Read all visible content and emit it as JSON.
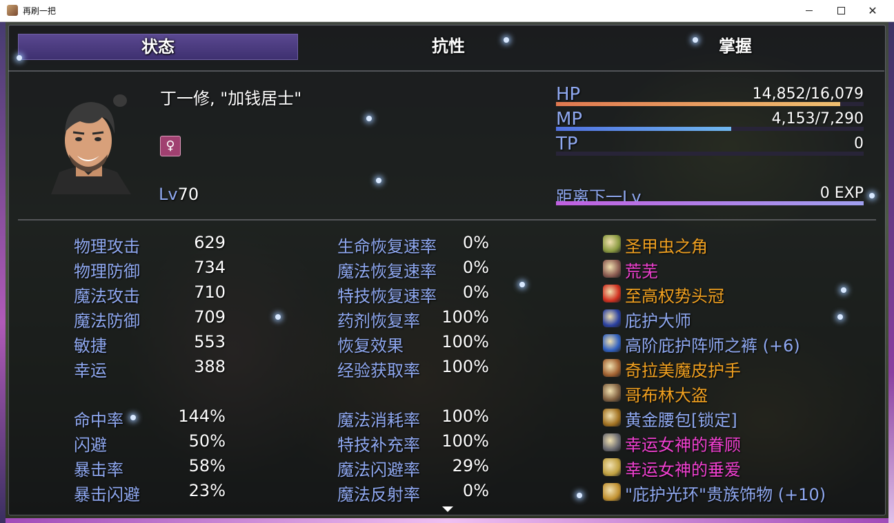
{
  "window": {
    "title": "再刷一把"
  },
  "tabs": [
    {
      "label": "状态"
    },
    {
      "label": "抗性"
    },
    {
      "label": "掌握"
    }
  ],
  "actor": {
    "name": "丁一修, \"加钱居士\"",
    "level_label": "Lv",
    "level": "70",
    "gender_icon": "female-icon"
  },
  "gauges": {
    "hp": {
      "label": "HP",
      "value": "14,852/16,079",
      "ratio": 0.924
    },
    "mp": {
      "label": "MP",
      "value": "4,153/7,290",
      "ratio": 0.57
    },
    "tp": {
      "label": "TP",
      "value": "0",
      "ratio": 0
    },
    "exp": {
      "label": "距离下一Lv",
      "value": "0 EXP",
      "ratio": 1
    }
  },
  "stats_left": [
    {
      "name": "物理攻击",
      "value": "629"
    },
    {
      "name": "物理防御",
      "value": "734"
    },
    {
      "name": "魔法攻击",
      "value": "710"
    },
    {
      "name": "魔法防御",
      "value": "709"
    },
    {
      "name": "敏捷",
      "value": "553"
    },
    {
      "name": "幸运",
      "value": "388"
    }
  ],
  "stats_left2": [
    {
      "name": "命中率",
      "value": "144%"
    },
    {
      "name": "闪避",
      "value": "50%"
    },
    {
      "name": "暴击率",
      "value": "58%"
    },
    {
      "name": "暴击闪避",
      "value": "23%"
    }
  ],
  "stats_right": [
    {
      "name": "生命恢复速率",
      "value": "0%"
    },
    {
      "name": "魔法恢复速率",
      "value": "0%"
    },
    {
      "name": "特技恢复速率",
      "value": "0%"
    },
    {
      "name": "药剂恢复率",
      "value": "100%"
    },
    {
      "name": "恢复效果",
      "value": "100%"
    },
    {
      "name": "经验获取率",
      "value": "100%"
    }
  ],
  "stats_right2": [
    {
      "name": "魔法消耗率",
      "value": "100%"
    },
    {
      "name": "特技补充率",
      "value": "100%"
    },
    {
      "name": "魔法闪避率",
      "value": "29%"
    },
    {
      "name": "魔法反射率",
      "value": "0%"
    }
  ],
  "equipment": [
    {
      "name": "圣甲虫之角",
      "color": "#f0a020",
      "icon": "horn-icon",
      "icon_color": "#8a9a40"
    },
    {
      "name": "荒芜",
      "color": "#f040d0",
      "icon": "orb-icon",
      "icon_color": "#8a5a50"
    },
    {
      "name": "至高权势头冠",
      "color": "#f0a020",
      "icon": "crown-icon",
      "icon_color": "#d03020"
    },
    {
      "name": "庇护大师",
      "color": "#8fa8f0",
      "icon": "robe-icon",
      "icon_color": "#2a40a0"
    },
    {
      "name": "高阶庇护阵师之裤 (+6)",
      "color": "#8fa8f0",
      "icon": "pants-icon",
      "icon_color": "#3060c0"
    },
    {
      "name": "奇拉美魔皮护手",
      "color": "#f0a020",
      "icon": "gloves-icon",
      "icon_color": "#a06030"
    },
    {
      "name": "哥布林大盗",
      "color": "#f0a020",
      "icon": "boots-icon",
      "icon_color": "#806040"
    },
    {
      "name": "黄金腰包[锁定]",
      "color": "#8fa8f0",
      "icon": "belt-icon",
      "icon_color": "#a07020"
    },
    {
      "name": "幸运女神的眷顾",
      "color": "#f040d0",
      "icon": "charm-icon",
      "icon_color": "#6a6a70"
    },
    {
      "name": "幸运女神的垂爱",
      "color": "#f040d0",
      "icon": "ring-icon",
      "icon_color": "#c0a040"
    },
    {
      "name": "\"庇护光环\"贵族饰物 (+10)",
      "color": "#8fa8f0",
      "icon": "amulet-icon",
      "icon_color": "#c09030"
    }
  ],
  "colors": {
    "system_label": "#8fa8f0",
    "normal_text": "#ffffff",
    "tab_selected": "#4a3a80"
  }
}
